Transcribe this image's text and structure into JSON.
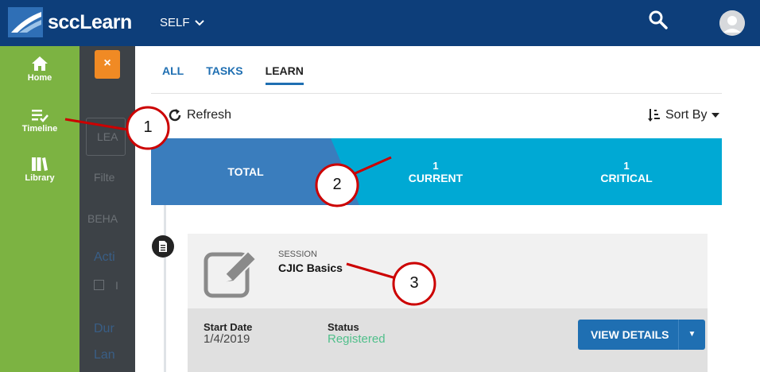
{
  "header": {
    "logo_text": "sccLearn",
    "self_menu_label": "SELF",
    "icons": [
      "search-icon",
      "user-avatar-icon",
      "chevron-down-icon"
    ]
  },
  "sidebar": {
    "items": [
      {
        "label": "Home",
        "icon": "home-icon"
      },
      {
        "label": "Timeline",
        "icon": "timeline-icon"
      },
      {
        "label": "Library",
        "icon": "library-icon"
      }
    ]
  },
  "background": {
    "close_symbol": "×",
    "box_text": "LEA",
    "filter_text": "Filte",
    "section_text": "BEHA",
    "link1": "Acti",
    "link2": "Dur",
    "link3": "Lan",
    "check_label": "I"
  },
  "tabs": [
    {
      "label": "ALL",
      "active": false
    },
    {
      "label": "TASKS",
      "active": false
    },
    {
      "label": "LEARN",
      "active": true
    }
  ],
  "toolbar": {
    "refresh_label": "Refresh",
    "sort_label": "Sort By"
  },
  "stats": {
    "total_label": "TOTAL",
    "current_count": "1",
    "current_label": "CURRENT",
    "critical_count": "1",
    "critical_label": "CRITICAL",
    "colors": {
      "total": "#3a7dbd",
      "other": "#00a9d4"
    }
  },
  "card": {
    "type_label": "SESSION",
    "title": "CJIC Basics",
    "start_date_label": "Start Date",
    "start_date_value": "1/4/2019",
    "status_label": "Status",
    "status_value": "Registered",
    "view_details_label": "VIEW DETAILS"
  },
  "callouts": [
    "1",
    "2",
    "3"
  ]
}
